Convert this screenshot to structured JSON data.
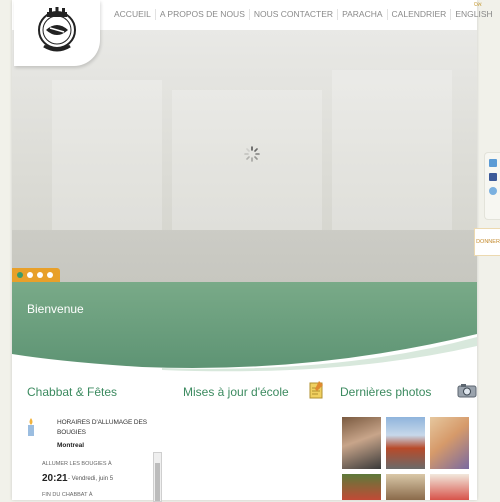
{
  "nav": {
    "items": [
      "ACCUEIL",
      "A PROPOS DE NOUS",
      "NOUS CONTACTER",
      "PARACHA",
      "CALENDRIER",
      "ENGLISH"
    ],
    "lang": "אס"
  },
  "hero": {
    "slide_count": 4,
    "active_slide": 1
  },
  "rail": {
    "donate": "DONNER"
  },
  "welcome": "Bienvenue",
  "columns": {
    "holidays": "Chabbat & Fêtes",
    "school": "Mises à jour d'école",
    "photos": "Dernières photos"
  },
  "schedule": {
    "title": "HORAIRES D'ALLUMAGE DES BOUGIES",
    "city": "Montreal",
    "candle_label": "ALLUMER LES BOUGIES À",
    "candle_time": "20:21",
    "candle_date": "- Vendredi, juin 5",
    "end_label": "FIN DU CHABBAT À"
  },
  "colors": {
    "green": "#3b8a5f",
    "orange": "#e8a02a",
    "banner": "#6fa382"
  }
}
